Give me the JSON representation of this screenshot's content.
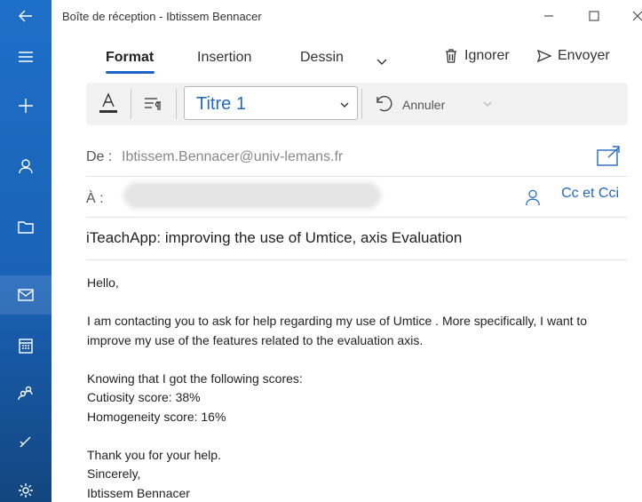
{
  "window": {
    "title": "Boîte de réception - Ibtissem Bennacer"
  },
  "rail": {
    "items": [
      {
        "icon": "back-arrow-icon"
      },
      {
        "icon": "menu-icon"
      },
      {
        "icon": "compose-plus-icon"
      },
      {
        "icon": "account-icon"
      },
      {
        "icon": "folder-icon"
      },
      {
        "icon": "mail-icon"
      },
      {
        "icon": "calendar-icon"
      },
      {
        "icon": "people-icon"
      },
      {
        "icon": "todo-icon"
      },
      {
        "icon": "settings-icon"
      }
    ]
  },
  "ribbon": {
    "tabs": [
      "Format",
      "Insertion",
      "Dessin"
    ],
    "active_tab": "Format",
    "discard_label": "Ignorer",
    "send_label": "Envoyer"
  },
  "toolbar": {
    "paragraph_style": "Titre 1",
    "undo_label": "Annuler"
  },
  "compose": {
    "from_label": "De :",
    "from_value": "Ibtissem.Bennacer@univ-lemans.fr",
    "to_label": "À :",
    "cc_label": "Cc et Cci",
    "subject": "iTeachApp: improving the use of Umtice, axis Evaluation",
    "body": {
      "greeting": "Hello,",
      "paragraph1": "I am contacting you to ask for help regarding my use of Umtice . More specifically, I want to improve my use of the features related to the evaluation axis.",
      "scores_intro": "Knowing that I got the following scores:",
      "score1": "Cutiosity score: 38%",
      "score2": "Homogeneity score: 16%",
      "thanks": "Thank you for your help.",
      "closing": "Sincerely,",
      "signature": "Ibtissem Bennacer"
    }
  },
  "colors": {
    "rail": "#1a62b8",
    "accent": "#2469c0",
    "toolbar_bg": "#f2f2f2"
  }
}
